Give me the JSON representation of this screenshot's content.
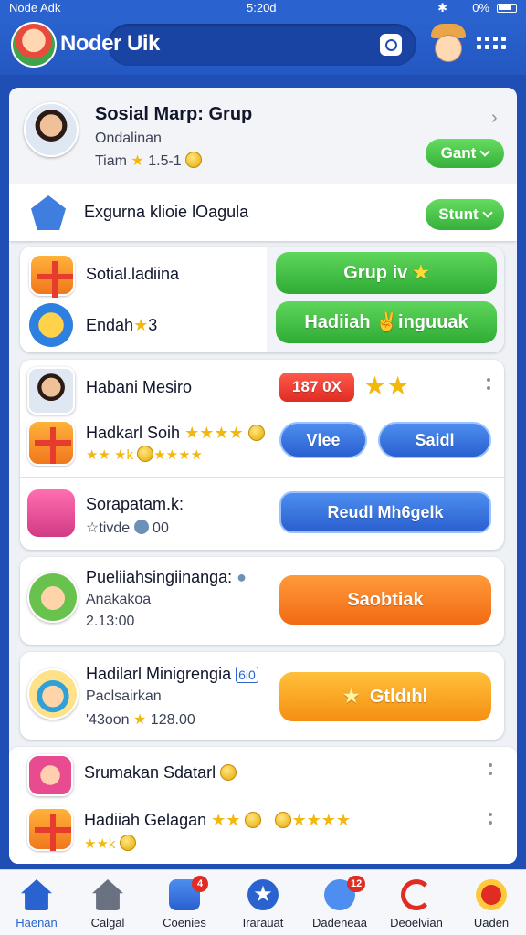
{
  "status_bar": {
    "left": "Node Adk",
    "time": "5:20d",
    "right": "0% ",
    "bluetooth": "✱"
  },
  "header": {
    "title": "Noder Uik",
    "search_icon": "search-icon",
    "menu_icon": "grid-icon"
  },
  "profile": {
    "name": "Sosial Marp: Grup",
    "subtitle": "Ondalinan",
    "meta_prefix": "Tiam",
    "meta_value": "1.5-1",
    "button": "Gant"
  },
  "group_row": {
    "label": "Exgurna klioie lOagula",
    "button": "Stunt"
  },
  "promo": {
    "items": [
      {
        "label": "Sotial.ladiina"
      },
      {
        "label": "Endah",
        "suffix": "3"
      }
    ],
    "buttons": [
      "Grup iv",
      "Hadiiah ✌inguuak"
    ]
  },
  "list": [
    {
      "title": "Habani Mesiro",
      "badge": "187  0X"
    },
    {
      "title": "Hadkarl Soih",
      "stars": "★★★★",
      "sub_stars": "★★ ★k",
      "btn1": "Vlee",
      "btn2": "Saidl"
    },
    {
      "title": "Sorapatam.k:",
      "sub": "☆tivde",
      "sub_value": "00",
      "button": "Reudl Mh6gelk"
    }
  ],
  "cards": [
    {
      "title": "Pueliiahsingiinanga:",
      "sub": "Anakakoa",
      "value": "2.13:00",
      "button": "Saobtiak"
    },
    {
      "title": "Hadilarl Minigrengia",
      "title_badge": "6i0",
      "sub": "Paclsairkan",
      "value_prefix": "'43oon",
      "value": "128.00",
      "button": "Gtldıhl"
    }
  ],
  "bottom_card": {
    "rows": [
      {
        "title": "Srumakan Sdatarl"
      },
      {
        "title": "Hadiiah Gelagan",
        "stars": "★★",
        "stars2": "★★★★",
        "sub_stars": "★★k"
      }
    ]
  },
  "nav": [
    {
      "label": "Haenan",
      "icon": "home-icon"
    },
    {
      "label": "Calgal",
      "icon": "house-icon"
    },
    {
      "label": "Coenies",
      "icon": "stack-icon",
      "badge": "4"
    },
    {
      "label": "Irarauat",
      "icon": "star-icon"
    },
    {
      "label": "Dadeneaa",
      "icon": "chat-icon",
      "badge": "12"
    },
    {
      "label": "Deoelvian",
      "icon": "refresh-icon"
    },
    {
      "label": "Uaden",
      "icon": "heart-icon"
    }
  ]
}
